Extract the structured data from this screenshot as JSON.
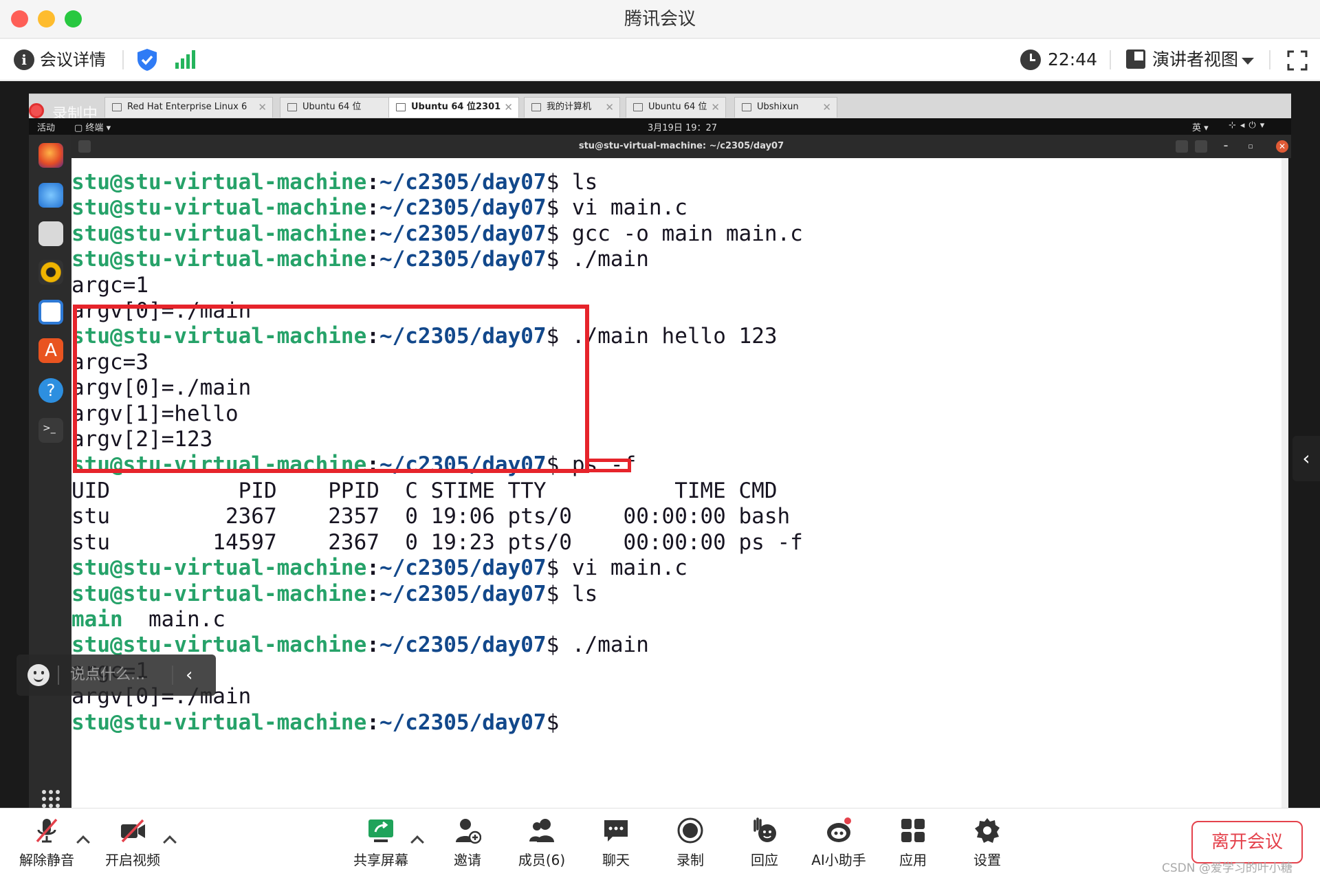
{
  "window": {
    "title": "腾讯会议"
  },
  "infobar": {
    "details_label": "会议详情",
    "time": "22:44",
    "view_label": "演讲者视图"
  },
  "recording_label": "录制中",
  "vm_tabs": [
    {
      "label": "Red Hat Enterprise Linux 6",
      "active": false
    },
    {
      "label": "Ubuntu 64 位",
      "active": false
    },
    {
      "label": "Ubuntu 64 位2301",
      "active": true
    },
    {
      "label": "我的计算机",
      "active": false
    },
    {
      "label": "Ubuntu 64 位",
      "active": false
    },
    {
      "label": "Ubshixun",
      "active": false
    }
  ],
  "ubuntu_panel": {
    "activities": "活动",
    "terminal_menu": "终端",
    "datetime": "3月19日 19：27",
    "lang": "英"
  },
  "terminal": {
    "title": "stu@stu-virtual-machine: ~/c2305/day07",
    "prompt_user": "stu@stu-virtual-machine",
    "prompt_path": "~/c2305/day07",
    "lines": [
      {
        "type": "prompt",
        "cmd": "ls"
      },
      {
        "type": "prompt",
        "cmd": "vi main.c"
      },
      {
        "type": "prompt",
        "cmd": "gcc -o main main.c"
      },
      {
        "type": "prompt",
        "cmd": "./main"
      },
      {
        "type": "output",
        "text": "argc=1"
      },
      {
        "type": "output",
        "text": "argv[0]=./main"
      },
      {
        "type": "prompt",
        "cmd": "./main hello 123"
      },
      {
        "type": "output",
        "text": "argc=3"
      },
      {
        "type": "output",
        "text": "argv[0]=./main"
      },
      {
        "type": "output",
        "text": "argv[1]=hello"
      },
      {
        "type": "output",
        "text": "argv[2]=123"
      },
      {
        "type": "prompt",
        "cmd": "ps -f"
      },
      {
        "type": "output",
        "text": "UID          PID    PPID  C STIME TTY          TIME CMD"
      },
      {
        "type": "output",
        "text": "stu         2367    2357  0 19:06 pts/0    00:00:00 bash"
      },
      {
        "type": "output",
        "text": "stu        14597    2367  0 19:23 pts/0    00:00:00 ps -f"
      },
      {
        "type": "prompt",
        "cmd": "vi main.c"
      },
      {
        "type": "prompt",
        "cmd": "ls"
      },
      {
        "type": "ls",
        "exe": "main",
        "rest": "  main.c"
      },
      {
        "type": "prompt",
        "cmd": "./main"
      },
      {
        "type": "output",
        "text": "argc=1"
      },
      {
        "type": "output",
        "text": "argv[0]=./main"
      },
      {
        "type": "prompt",
        "cmd": ""
      }
    ]
  },
  "chat": {
    "placeholder": "说点什么..."
  },
  "toolbar": {
    "items": [
      {
        "name": "unmute",
        "label": "解除静音"
      },
      {
        "name": "start-video",
        "label": "开启视频"
      },
      {
        "name": "share-screen",
        "label": "共享屏幕"
      },
      {
        "name": "invite",
        "label": "邀请"
      },
      {
        "name": "members",
        "label": "成员(6)"
      },
      {
        "name": "chat",
        "label": "聊天"
      },
      {
        "name": "record",
        "label": "录制"
      },
      {
        "name": "reactions",
        "label": "回应"
      },
      {
        "name": "ai-assistant",
        "label": "AI小助手"
      },
      {
        "name": "apps",
        "label": "应用"
      },
      {
        "name": "settings",
        "label": "设置"
      }
    ],
    "leave_label": "离开会议"
  },
  "watermark": "CSDN @爱学习的叶小糖",
  "colors": {
    "prompt_user": "#26a269",
    "prompt_path": "#12488b",
    "highlight": "#e6242b",
    "leave": "#e4424c"
  }
}
